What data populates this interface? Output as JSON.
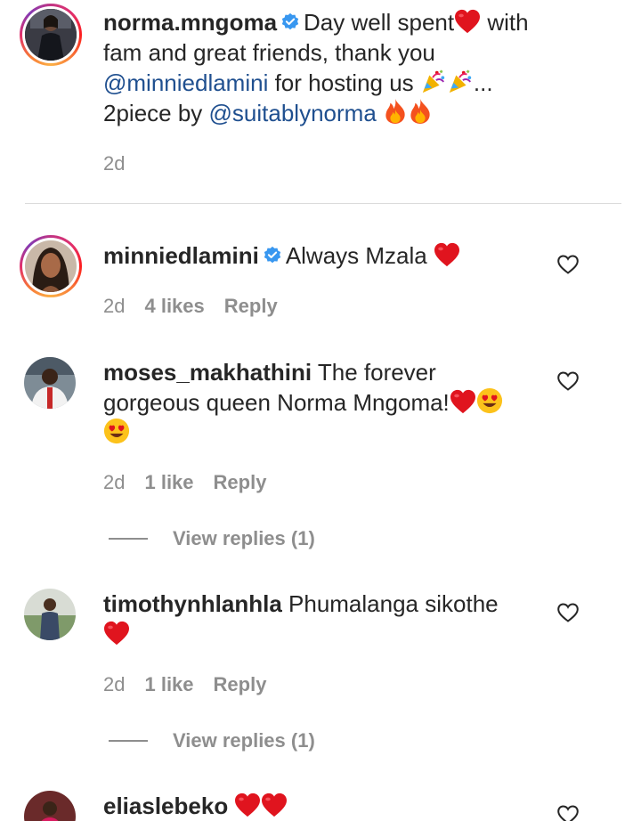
{
  "caption": {
    "username": "norma.mngoma",
    "text_1": "Day well spent",
    "text_2": " with fam and great friends, thank you ",
    "mention_1": "@minniedlamini",
    "text_3": " for hosting us ",
    "ellipsis": "...",
    "text_4": "2piece by ",
    "mention_2": "@suitablynorma",
    "time": "2d"
  },
  "comments": [
    {
      "username": "minniedlamini",
      "text": "Always Mzala",
      "time": "2d",
      "likes": "4 likes",
      "reply": "Reply"
    },
    {
      "username": "moses_makhathini",
      "text": "The forever gorgeous queen Norma Mngoma!",
      "time": "2d",
      "likes": "1 like",
      "reply": "Reply",
      "view_replies": "View replies (1)"
    },
    {
      "username": "timothynhlanhla",
      "text": "Phumalanga sikothe",
      "time": "2d",
      "likes": "1 like",
      "reply": "Reply",
      "view_replies": "View replies (1)"
    },
    {
      "username": "eliaslebeko",
      "text": ""
    }
  ],
  "colors": {
    "verified": "#3897f0",
    "heart_emoji": "#e0141e",
    "mention": "#1f4f8f",
    "meta": "#8e8e8e"
  }
}
